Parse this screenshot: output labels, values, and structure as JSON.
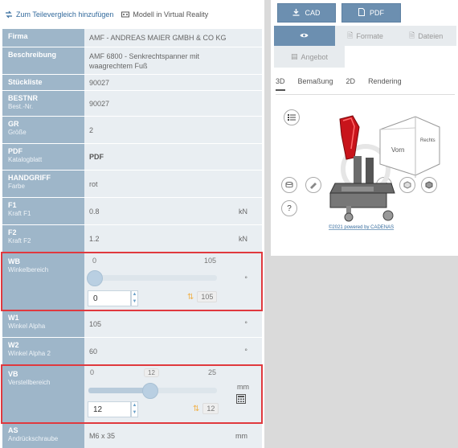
{
  "toplinks": {
    "compare": "Zum Teilevergleich hinzufügen",
    "vr": "Modell in Virtual Reality"
  },
  "rows": {
    "firma": {
      "label": "Firma",
      "value": "AMF - ANDREAS MAIER GMBH & CO KG"
    },
    "beschreibung": {
      "label": "Beschreibung",
      "value_line1": "AMF 6800 - Senkrechtspanner mit",
      "value_line2": "waagrechtem Fuß"
    },
    "stueckliste": {
      "label": "Stückliste",
      "value": "90027"
    },
    "bestnr": {
      "label": "BESTNR",
      "sub": "Best.-Nr.",
      "value": "90027"
    },
    "gr": {
      "label": "GR",
      "sub": "Größe",
      "value": "2"
    },
    "pdf": {
      "label": "PDF",
      "sub": "Katalogblatt",
      "value": "PDF"
    },
    "handgriff": {
      "label": "HANDGRIFF",
      "sub": "Farbe",
      "value": "rot"
    },
    "f1": {
      "label": "F1",
      "sub": "Kraft F1",
      "value": "0.8",
      "unit": "kN"
    },
    "f2": {
      "label": "F2",
      "sub": "Kraft F2",
      "value": "1.2",
      "unit": "kN"
    },
    "wb": {
      "label": "WB",
      "sub": "Winkelbereich",
      "min": "0",
      "max": "105",
      "value": "0",
      "reset_value": "105",
      "unit": "°",
      "level": 0
    },
    "w1": {
      "label": "W1",
      "sub": "Winkel Alpha",
      "value": "105",
      "unit": "°"
    },
    "w2": {
      "label": "W2",
      "sub": "Winkel Alpha 2",
      "value": "60",
      "unit": "°"
    },
    "vb": {
      "label": "VB",
      "sub": "Verstellbereich",
      "min": "0",
      "max": "25",
      "current": "12",
      "value": "12",
      "reset_value": "12",
      "unit": "mm",
      "level": 0.48
    },
    "as": {
      "label": "AS",
      "sub": "Andrückschraube",
      "value": "M6 x 35",
      "unit": "mm"
    }
  },
  "right": {
    "cad_label": "CAD",
    "pdf_label": "PDF",
    "tab_formate": "Formate",
    "tab_dateien": "Dateien",
    "tab_angebot": "Angebot",
    "view_tabs": [
      "3D",
      "Bemaßung",
      "2D",
      "Rendering"
    ],
    "cube_front": "Vorn",
    "cube_right": "Rechts",
    "footer": "©2021 powered by CADENAS"
  },
  "colors": {
    "label_bg": "#9eb6c9",
    "value_bg": "#e9eef2",
    "button_blue": "#6c8fb0",
    "highlight_red": "#e0393e"
  }
}
